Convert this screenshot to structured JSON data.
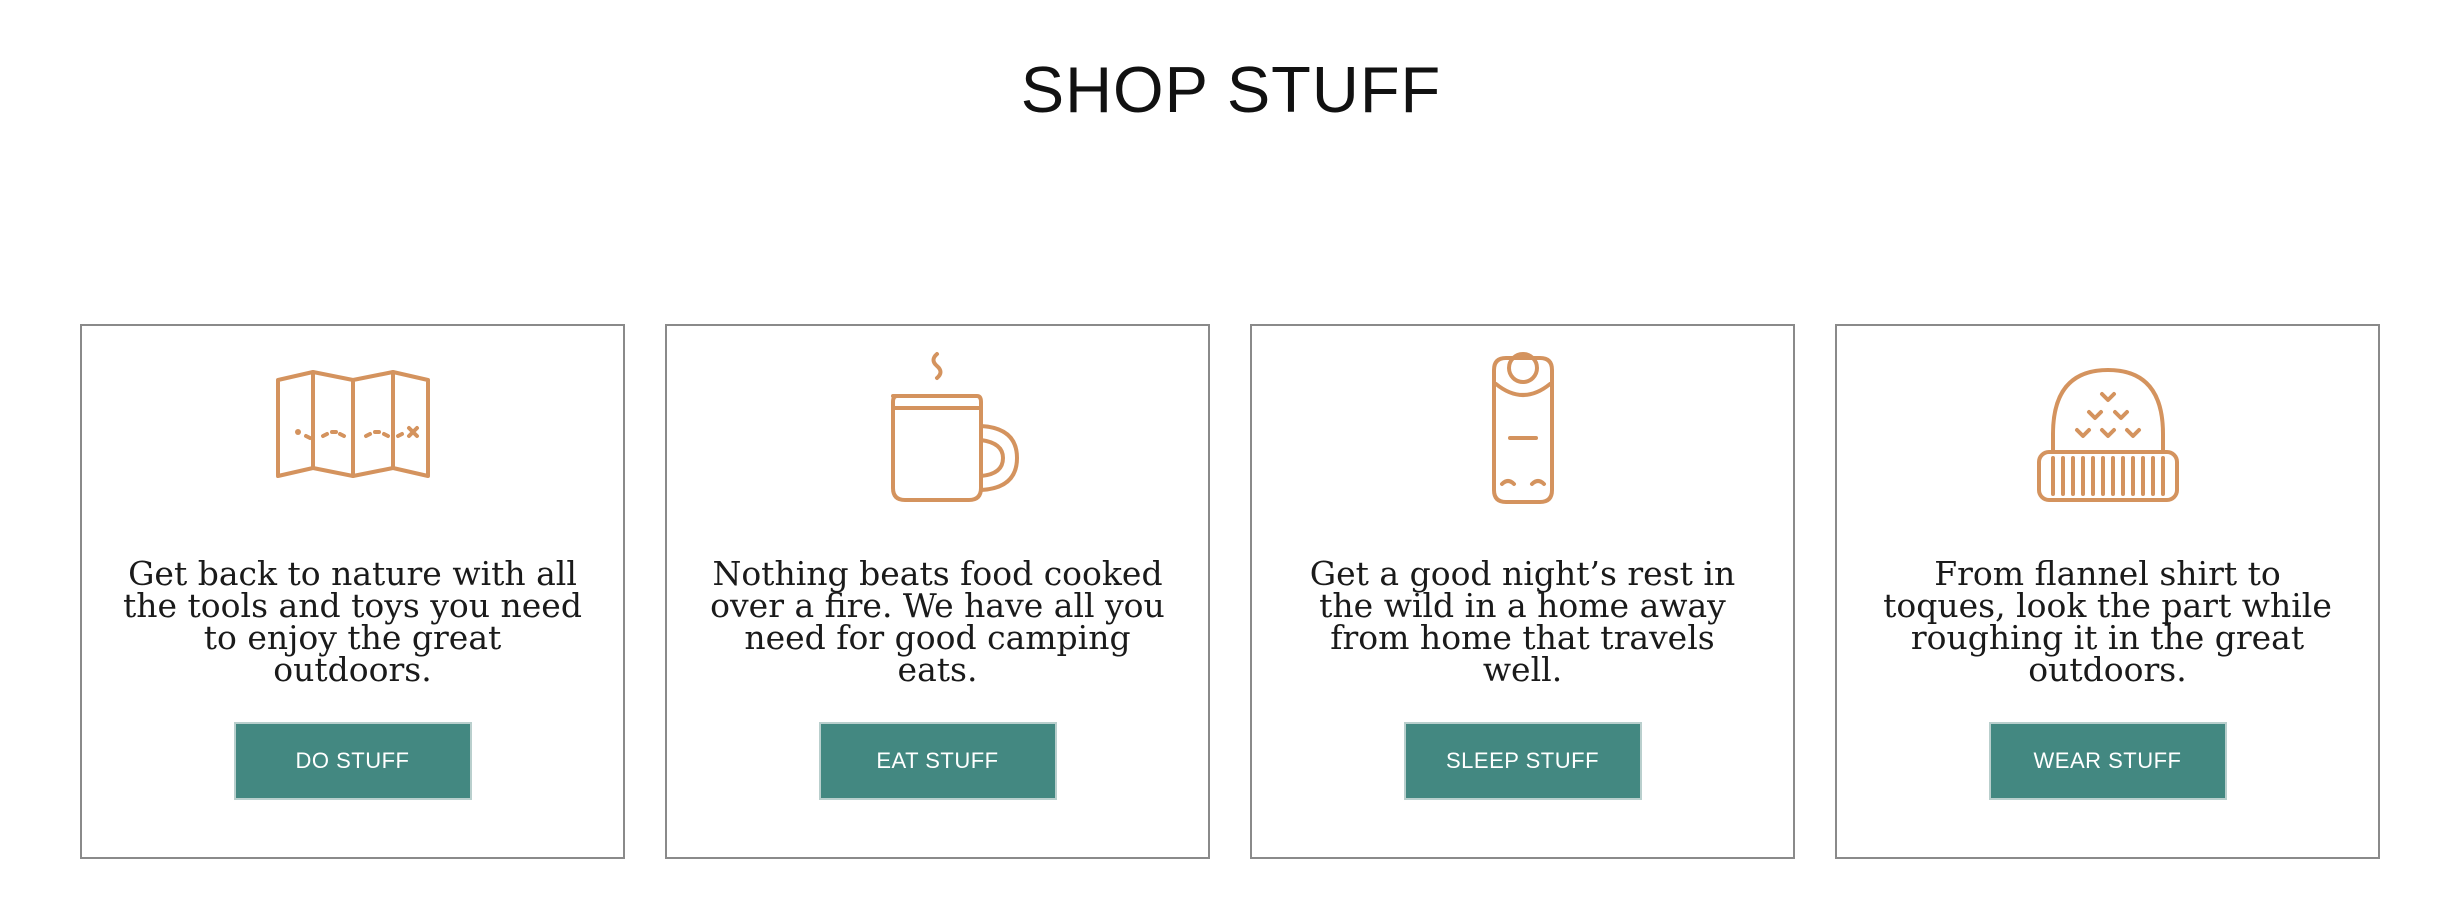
{
  "header": {
    "title": "SHOP STUFF"
  },
  "accent_color": "#d4935e",
  "button_color": "#438881",
  "cards": [
    {
      "icon": "folded-map-icon",
      "description": "Get back to nature with all the tools and toys you need to enjoy the great outdoors.",
      "button_label": "DO STUFF"
    },
    {
      "icon": "camping-mug-icon",
      "description": "Nothing beats food cooked over a fire. We have all you need for good camping eats.",
      "button_label": "EAT STUFF"
    },
    {
      "icon": "sleeping-bag-icon",
      "description": "Get a good night’s rest in the wild in a home away from home that travels well.",
      "button_label": "SLEEP STUFF"
    },
    {
      "icon": "toque-hat-icon",
      "description": "From flannel shirt to toques, look the part while roughing it in the great outdoors.",
      "button_label": "WEAR STUFF"
    }
  ]
}
